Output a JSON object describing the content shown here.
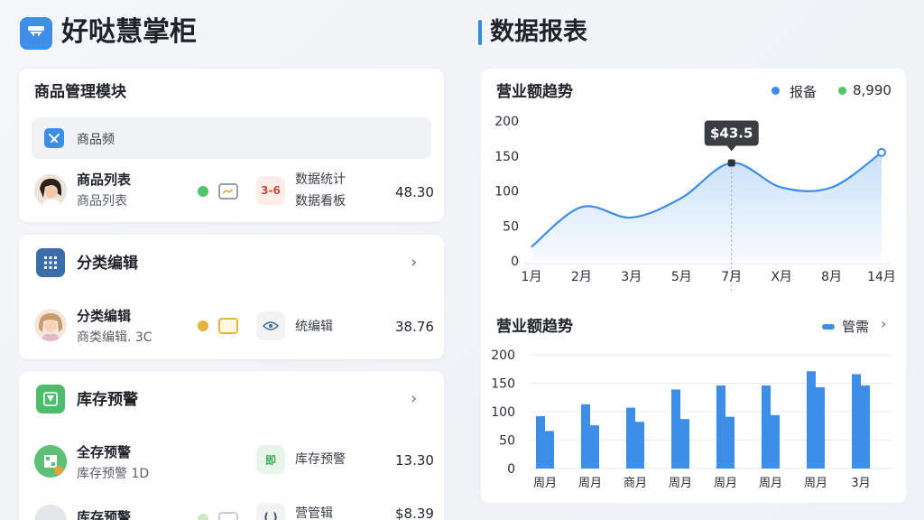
{
  "header": {
    "app_title": "好哒慧掌柜",
    "report_title": "数据报表"
  },
  "product_card": {
    "title": "商品管理模块",
    "sub_label": "商品频",
    "row": {
      "name": "商品列表",
      "sub": "商品列表",
      "tag_badge": "3-6",
      "tag_line1": "数据统计",
      "tag_line2": "数据看板",
      "amount": "48.30"
    }
  },
  "category_card": {
    "title": "分类编辑",
    "row": {
      "name": "分类编辑",
      "sub": "商类编辑. 3C",
      "tag_line1": "统编辑",
      "amount": "38.76"
    }
  },
  "stock_card": {
    "title": "库存预警",
    "row": {
      "name": "全存预警",
      "sub": "库存预警 1D",
      "tag_badge": "即",
      "tag_line1": "库存预警",
      "amount": "13.30"
    },
    "row2": {
      "name": "库存预警",
      "tag_line1": "营管辑",
      "amount": "$8.39"
    }
  },
  "line_chart_card": {
    "title": "营业额趋势",
    "legend": [
      {
        "label": "报备",
        "color": "#3d8ee6"
      },
      {
        "label": "8,990",
        "color": "#52c46b"
      }
    ],
    "tooltip": "$43.5"
  },
  "bar_chart_card": {
    "title": "营业额趋势",
    "legend_label": "管需"
  },
  "chart_data": [
    {
      "type": "line",
      "title": "营业额趋势",
      "x": [
        "1月",
        "2月",
        "3月",
        "5月",
        "7月",
        "X月",
        "8月",
        "14月"
      ],
      "y_ticks": [
        "0",
        "50",
        "100",
        "150",
        "200"
      ],
      "ylim": [
        0,
        200
      ],
      "series": [
        {
          "name": "报备",
          "values": [
            20,
            77,
            62,
            90,
            140,
            105,
            105,
            155
          ]
        }
      ],
      "tooltip": {
        "category": "7月",
        "value": "$43.5"
      },
      "color": "#3d8ee6"
    },
    {
      "type": "bar",
      "title": "营业额趋势",
      "categories": [
        "周月",
        "周月",
        "商月",
        "周月",
        "周月",
        "周月",
        "周月",
        "3月"
      ],
      "y_ticks": [
        "0",
        "50",
        "100",
        "150",
        "200"
      ],
      "ylim": [
        0,
        200
      ],
      "series": [
        {
          "name": "管需",
          "values": [
            92,
            113,
            107,
            139,
            146,
            146,
            171,
            166
          ]
        },
        {
          "name": "",
          "values": [
            66,
            76,
            82,
            87,
            91,
            94,
            143,
            146
          ]
        }
      ],
      "color": "#3d8ee6"
    }
  ]
}
